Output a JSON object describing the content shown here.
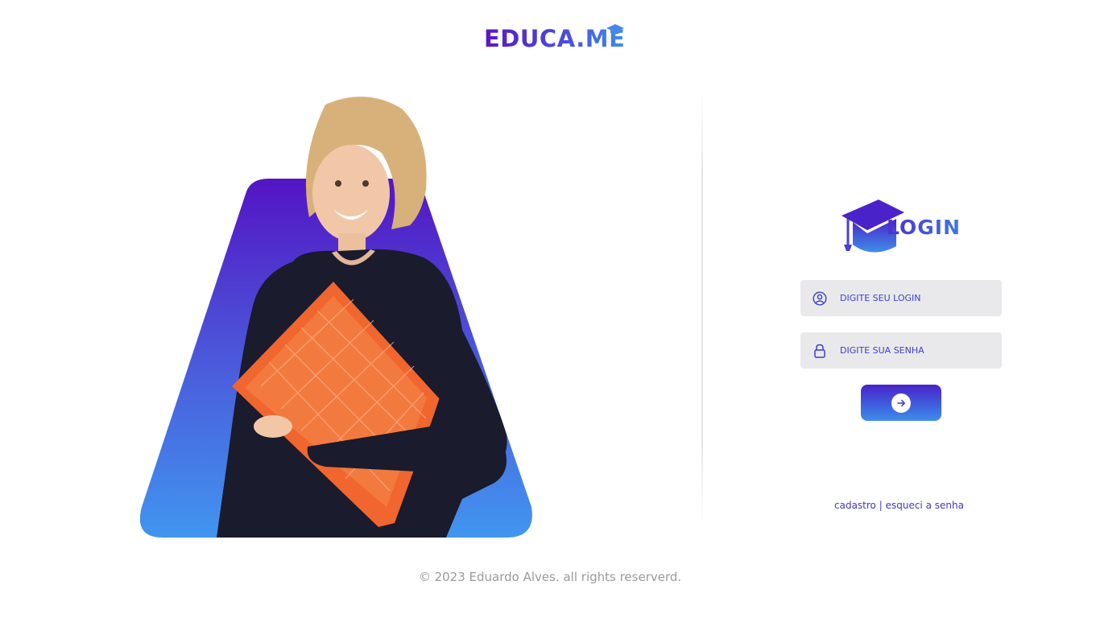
{
  "brand": {
    "name": "EDUCA.ME",
    "icon": "graduation-cap-icon"
  },
  "login": {
    "title": "LOGIN",
    "username_placeholder": "DIGITE SEU LOGIN",
    "password_placeholder": "DIGITE SUA SENHA",
    "username_icon": "user-circle-icon",
    "password_icon": "lock-icon",
    "submit_icon": "arrow-right-icon"
  },
  "links": {
    "register": "cadastro",
    "separator": "|",
    "forgot": "esqueci a senha"
  },
  "footer": {
    "text": "© 2023 Eduardo Alves. all rights reserverd."
  },
  "colors": {
    "primary_purple": "#5016c6",
    "primary_blue": "#3f8fe8",
    "field_bg": "#e9e9ec",
    "folder_orange": "#f0662e"
  }
}
